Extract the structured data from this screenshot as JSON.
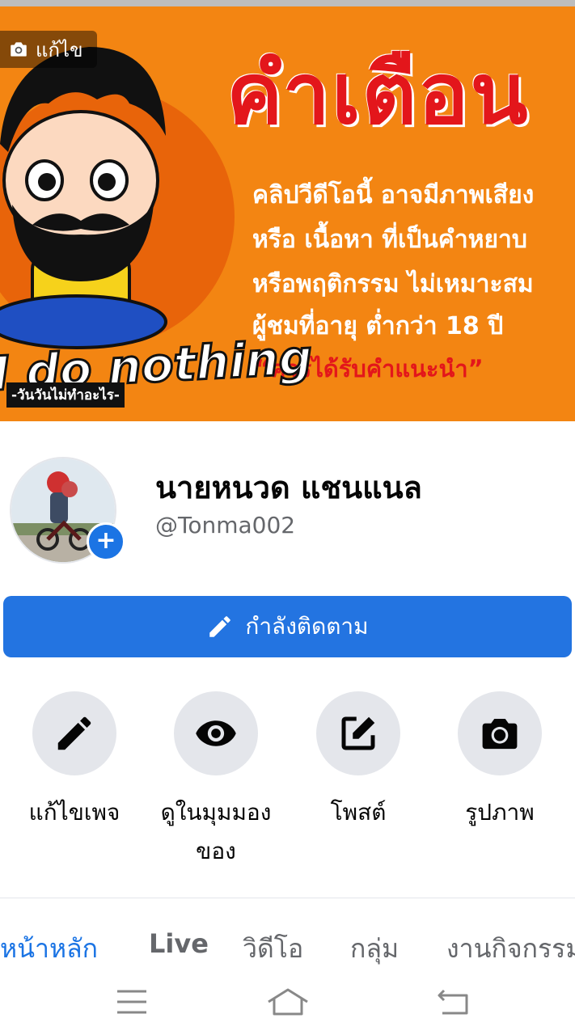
{
  "cover": {
    "edit_label": "แก้ไข",
    "warning_title": "คำเตือน",
    "warning_lines": [
      "คลิปวีดีโอนี้ อาจมีภาพเสียง",
      "หรือ เนื้อหา ที่เป็นคำหยาบ",
      "หรือพฤติกรรม ไม่เหมาะสม",
      "ผู้ชมที่อายุ ต่ำกว่า 18 ปี"
    ],
    "warning_quote": "“ควรได้รับคำแนะนำ”",
    "slogan": "I do nothing",
    "slogan_sub": "-วันวันไม่ทำอะไร-"
  },
  "profile": {
    "name": "นายหนวด แชนแนล",
    "handle": "@Tonma002",
    "add_icon": "+"
  },
  "follow_button": {
    "label": "กำลังติดตาม"
  },
  "actions": [
    {
      "label": "แก้ไขเพจ",
      "icon": "pencil-icon"
    },
    {
      "label": "ดูในมุมมองของ",
      "icon": "eye-icon"
    },
    {
      "label": "โพสต์",
      "icon": "compose-icon"
    },
    {
      "label": "รูปภาพ",
      "icon": "camera-icon"
    }
  ],
  "tabs": [
    {
      "label": "หน้าหลัก",
      "active": true
    },
    {
      "label": "Live"
    },
    {
      "label": "วิดีโอ"
    },
    {
      "label": "กลุ่ม"
    },
    {
      "label": "งานกิจกรรม"
    }
  ],
  "colors": {
    "accent": "#1b74e4",
    "button": "#2374e1",
    "cover_bg": "#f38512",
    "warning_red": "#e3161b"
  },
  "system_nav": [
    "menu-icon",
    "home-icon",
    "back-icon"
  ]
}
